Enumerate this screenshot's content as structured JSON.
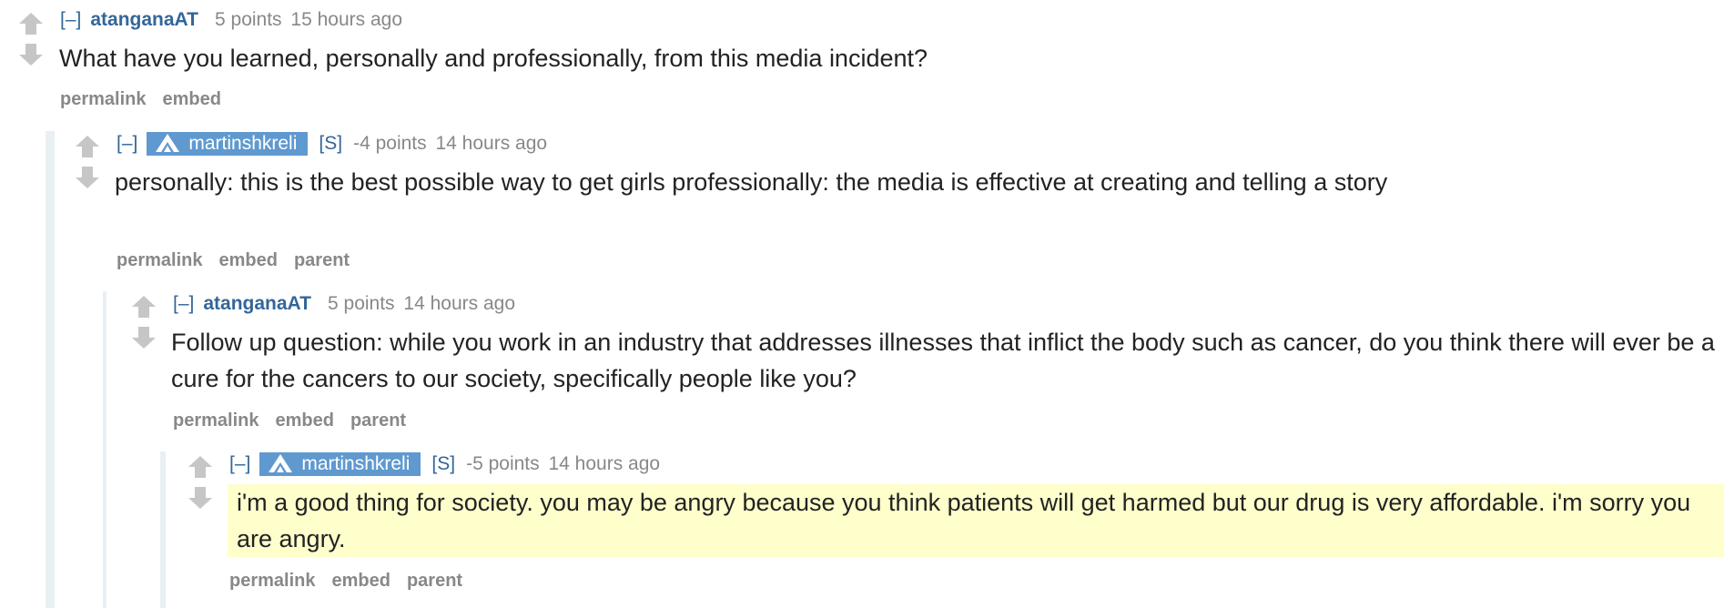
{
  "comments": [
    {
      "author": "atanganaAT",
      "expand": "[–]",
      "score": "5 points",
      "age": "15 hours ago",
      "body": "What have you learned, personally and professionally, from this media incident?",
      "actions": [
        "permalink",
        "embed"
      ]
    },
    {
      "author": "martinshkreli",
      "expand": "[–]",
      "flair": "[S]",
      "score": "-4 points",
      "age": "14 hours ago",
      "body": "personally: this is the best possible way to get girls professionally: the media is effective at creating and telling a story",
      "actions": [
        "permalink",
        "embed",
        "parent"
      ]
    },
    {
      "author": "atanganaAT",
      "expand": "[–]",
      "score": "5 points",
      "age": "14 hours ago",
      "body": "Follow up question: while you work in an industry that addresses illnesses that inflict the body such as cancer, do you think there will ever be a cure for the cancers to our society, specifically people like you?",
      "actions": [
        "permalink",
        "embed",
        "parent"
      ]
    },
    {
      "author": "martinshkreli",
      "expand": "[–]",
      "flair": "[S]",
      "score": "-5 points",
      "age": "14 hours ago",
      "body": "i'm a good thing for society. you may be angry because you think patients will get harmed but our drug is very affordable. i'm sorry you are angry.",
      "actions": [
        "permalink",
        "embed",
        "parent"
      ]
    }
  ],
  "colors": {
    "author": "#336699",
    "submitter_bg": "#5f99cf",
    "highlight_bg": "#ffffcc",
    "thread_bar": "#e8f0f4",
    "arrow": "#c6c6c6"
  },
  "icons": {
    "upvote": "up-arrow-icon",
    "downvote": "down-arrow-icon",
    "submitter": "ama-logo-icon"
  }
}
